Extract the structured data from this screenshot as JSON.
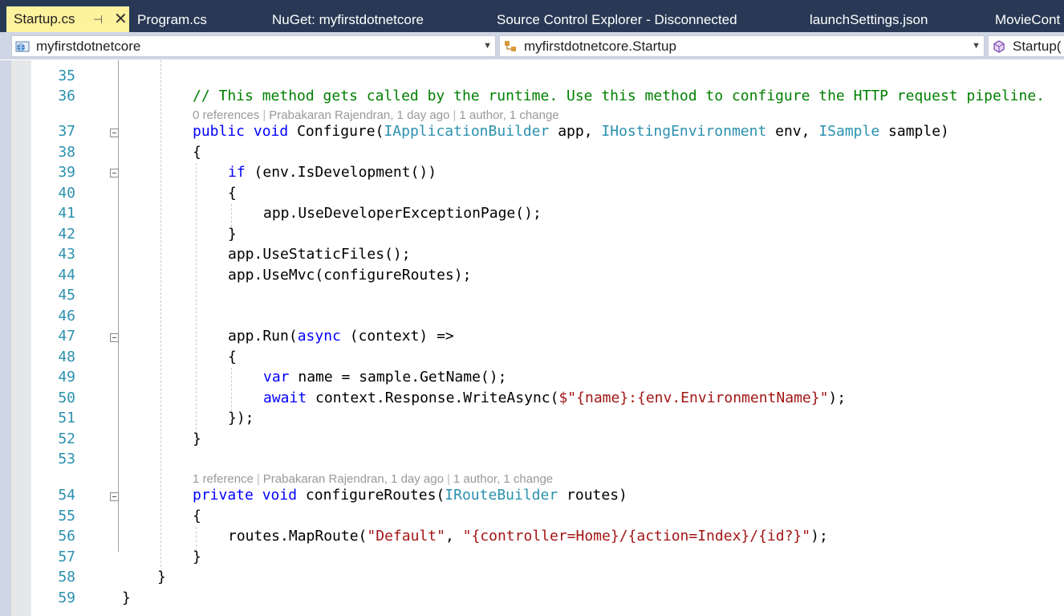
{
  "tabs": [
    {
      "label": "Startup.cs",
      "active": true
    },
    {
      "label": "Program.cs"
    },
    {
      "label": "NuGet: myfirstdotnetcore"
    },
    {
      "label": "Source Control Explorer - Disconnected"
    },
    {
      "label": "launchSettings.json"
    },
    {
      "label": "MovieCont"
    }
  ],
  "tab_pin_icon": "pin-icon",
  "tab_close_icon": "close-icon",
  "nav": {
    "project": "myfirstdotnetcore",
    "type": "myfirstdotnetcore.Startup",
    "member": "Startup("
  },
  "lens": {
    "configure": {
      "refs": "0 references",
      "author": "Prabakaran Rajendran, 1 day ago",
      "changes": "1 author, 1 change"
    },
    "routes": {
      "refs": "1 reference",
      "author": "Prabakaran Rajendran, 1 day ago",
      "changes": "1 author, 1 change"
    }
  },
  "lines": [
    {
      "n": "35"
    },
    {
      "n": "36",
      "code": "        // This method gets called by the runtime. Use this method to configure the HTTP request pipeline."
    },
    {
      "n": "37",
      "code": "        public void Configure(IApplicationBuilder app, IHostingEnvironment env, ISample sample)"
    },
    {
      "n": "38",
      "code": "        {"
    },
    {
      "n": "39",
      "code": "            if (env.IsDevelopment())"
    },
    {
      "n": "40",
      "code": "            {"
    },
    {
      "n": "41",
      "code": "                app.UseDeveloperExceptionPage();"
    },
    {
      "n": "42",
      "code": "            }"
    },
    {
      "n": "43",
      "code": "            app.UseStaticFiles();"
    },
    {
      "n": "44",
      "code": "            app.UseMvc(configureRoutes);"
    },
    {
      "n": "45"
    },
    {
      "n": "46"
    },
    {
      "n": "47",
      "code": "            app.Run(async (context) =>"
    },
    {
      "n": "48",
      "code": "            {"
    },
    {
      "n": "49",
      "code": "                var name = sample.GetName();"
    },
    {
      "n": "50",
      "code": "                await context.Response.WriteAsync($\"{name}:{env.EnvironmentName}\");"
    },
    {
      "n": "51",
      "code": "            });"
    },
    {
      "n": "52",
      "code": "        }"
    },
    {
      "n": "53"
    },
    {
      "n": "54",
      "code": "        private void configureRoutes(IRouteBuilder routes)"
    },
    {
      "n": "55",
      "code": "        {"
    },
    {
      "n": "56",
      "code": "            routes.MapRoute(\"Default\", \"{controller=Home}/{action=Index}/{id?}\");"
    },
    {
      "n": "57",
      "code": "        }"
    },
    {
      "n": "58",
      "code": "    }"
    },
    {
      "n": "59",
      "code": "}"
    }
  ]
}
